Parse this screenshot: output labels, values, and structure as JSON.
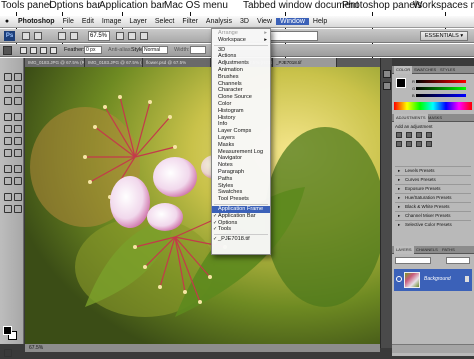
{
  "callouts": {
    "tools_panel": "Tools panel",
    "options_bar": "Options bar",
    "application_bar": "Application bar",
    "mac_os_menu": "Mac OS menu",
    "tabbed_window_document": "Tabbed window document",
    "photoshop_panels": "Photoshop panels",
    "workspaces_menu": "Workspaces menu"
  },
  "menubar": {
    "app": "Photoshop",
    "items": [
      "File",
      "Edit",
      "Image",
      "Layer",
      "Select",
      "Filter",
      "Analysis",
      "3D",
      "View",
      "Window",
      "Help"
    ]
  },
  "appbar": {
    "logo": "Ps",
    "zoom": "67.5%",
    "workspace": "ESSENTIALS ▾"
  },
  "optionsbar": {
    "feather_label": "Feather:",
    "feather_value": "0 px",
    "antialias_label": "Anti-alias",
    "style_label": "Style:",
    "style_value": "Normal",
    "width_label": "Width:",
    "height_label": "Height:"
  },
  "document": {
    "tabs": [
      "IMG_0183.JPG @ 67.5% (RGB/8*)",
      "IMG_0183.JPG @ 67.5% (RGB/8*)",
      "flower.psd @ 67.5%",
      "_PJE7018.tif @ 67.5% (RGB/8)",
      "_PJE7018.tif"
    ],
    "status": "67.5%"
  },
  "window_menu": {
    "items": [
      {
        "label": "Arrange",
        "dim": true,
        "arrow": true
      },
      {
        "label": "Workspace",
        "arrow": true
      },
      {
        "sep": true
      },
      {
        "label": "3D"
      },
      {
        "label": "Actions"
      },
      {
        "label": "Adjustments"
      },
      {
        "label": "Animation"
      },
      {
        "label": "Brushes"
      },
      {
        "label": "Channels"
      },
      {
        "label": "Character"
      },
      {
        "label": "Clone Source"
      },
      {
        "label": "Color"
      },
      {
        "label": "Histogram"
      },
      {
        "label": "History"
      },
      {
        "label": "Info"
      },
      {
        "label": "Layer Comps"
      },
      {
        "label": "Layers"
      },
      {
        "label": "Masks"
      },
      {
        "label": "Measurement Log"
      },
      {
        "label": "Navigator"
      },
      {
        "label": "Notes"
      },
      {
        "label": "Paragraph"
      },
      {
        "label": "Paths"
      },
      {
        "label": "Styles"
      },
      {
        "label": "Swatches"
      },
      {
        "label": "Tool Presets"
      },
      {
        "sep": true
      },
      {
        "label": "Application Frame",
        "selected": true
      },
      {
        "label": "Application Bar",
        "checked": true
      },
      {
        "label": "Options",
        "checked": true
      },
      {
        "label": "Tools",
        "checked": true
      },
      {
        "sep": true
      },
      {
        "label": "_PJE7018.tif",
        "checked": true
      }
    ]
  },
  "panels": {
    "color_tabs": [
      "COLOR",
      "SWATCHES",
      "STYLES"
    ],
    "rgb_labels": [
      "R",
      "G",
      "B"
    ],
    "adjust_tabs": [
      "ADJUSTMENTS",
      "MASKS"
    ],
    "adjust_header": "Add an adjustment",
    "presets": [
      "Levels Presets",
      "Curves Presets",
      "Exposure Presets",
      "Hue/Saturation Presets",
      "Black & White Presets",
      "Channel Mixer Presets",
      "Selective Color Presets"
    ],
    "layers_tabs": [
      "LAYERS",
      "CHANNELS",
      "PATHS"
    ],
    "layer_name": "Background"
  },
  "colors": {
    "menu_highlight": "#3b61b8",
    "workspace_bg": "#3a3a3a",
    "chrome_gray": "#b9b9b9"
  },
  "icons": [
    "apple-icon",
    "ps-logo-icon",
    "hand-icon",
    "zoom-icon",
    "rotate-icon",
    "arrange-icon",
    "screen-mode-icon",
    "marquee-tool-icon",
    "eye-icon",
    "lock-icon"
  ]
}
